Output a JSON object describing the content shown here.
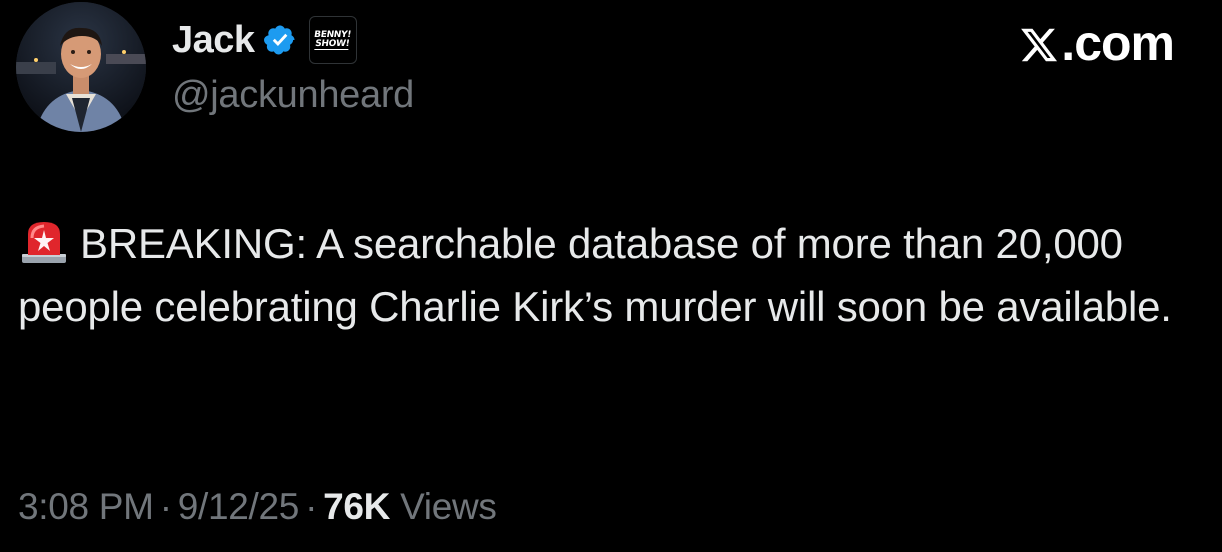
{
  "author": {
    "display_name": "Jack",
    "handle": "@jackunheard",
    "verified_icon": "verified-badge-icon",
    "affiliation_badge": {
      "line1": "BENNY!",
      "line2": "SHOW!"
    }
  },
  "brand": {
    "text": ".com",
    "icon": "x-logo-icon"
  },
  "tweet": {
    "emoji": "rotating-light-siren-icon",
    "text": "BREAKING: A searchable database of more than 20,000 people celebrating Charlie Kirk’s murder will soon be available."
  },
  "meta": {
    "time": "3:08 PM",
    "date": "9/12/25",
    "views_count": "76K",
    "views_label": "Views",
    "separator": "·"
  },
  "colors": {
    "background": "#000000",
    "primary_text": "#e7e9ea",
    "secondary_text": "#71767b",
    "verified_blue": "#1d9bf0"
  }
}
